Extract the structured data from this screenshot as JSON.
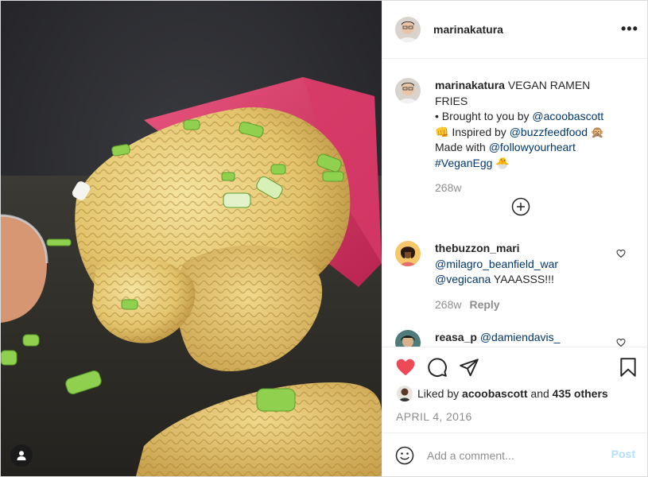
{
  "post": {
    "author": "marinakatura",
    "more_icon": "more-horizontal-icon",
    "more_label": "•••",
    "tag_icon": "user-tag-icon"
  },
  "caption": {
    "username": "marinakatura",
    "line1": "VEGAN RAMEN FRIES",
    "line2_prefix": "• Brought to you by",
    "mention1": "@acoobascott",
    "emoji1": "👊",
    "line3_prefix": "Inspired by",
    "mention2": "@buzzfeedfood",
    "emoji2": "🙊",
    "line4_prefix": "Made with",
    "mention3": "@followyourheart",
    "hashtag": "#VeganEgg",
    "emoji3": "🐣",
    "time": "268w"
  },
  "load_more_icon": "plus-circle-icon",
  "comments": [
    {
      "username": "thebuzzon_mari",
      "mention1": "@milagro_beanfield_war",
      "mention2": "@vegicana",
      "text": "YAAASSS!!!",
      "time": "268w",
      "reply": "Reply"
    },
    {
      "username": "reasa_p",
      "mention1": "@damiendavis_"
    }
  ],
  "actions": {
    "like_icon": "heart-filled-icon",
    "comment_icon": "comment-icon",
    "share_icon": "share-icon",
    "save_icon": "bookmark-icon",
    "like_color": "#ed4956"
  },
  "likes": {
    "prefix": "Liked by",
    "user": "acoobascott",
    "joiner": "and",
    "count": "435 others"
  },
  "date": "APRIL 4, 2016",
  "add_comment": {
    "placeholder": "Add a comment...",
    "post_label": "Post",
    "emoji_icon": "smiley-icon"
  }
}
